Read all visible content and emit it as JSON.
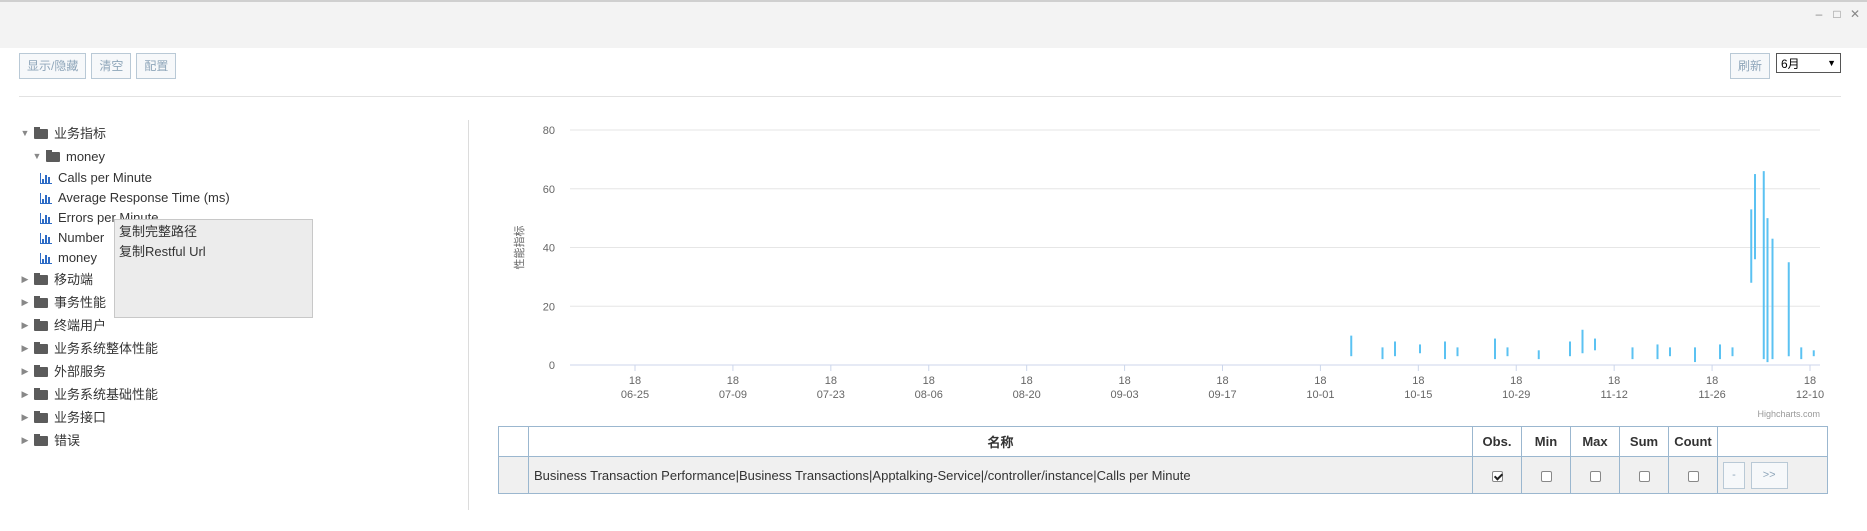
{
  "window": {
    "minimize_icon": "–",
    "maximize_icon": "□",
    "close_icon": "✕"
  },
  "toolbar": {
    "show_hide": "显示/隐藏",
    "clear": "清空",
    "config": "配置"
  },
  "right_toolbar": {
    "refresh": "刷新",
    "month_select": "6月",
    "select_arrow": "▼"
  },
  "tree": {
    "root": "业务指标",
    "child": "money",
    "metrics": [
      "Calls per Minute",
      "Average Response Time (ms)",
      "Errors per Minute",
      "Number",
      "money"
    ],
    "groups": [
      "移动端",
      "事务性能",
      "终端用户",
      "业务系统整体性能",
      "外部服务",
      "业务系统基础性能",
      "业务接口",
      "错误"
    ]
  },
  "context_menu": {
    "items": [
      "复制完整路径",
      "复制Restful Url"
    ]
  },
  "chart_data": {
    "type": "line",
    "ylabel": "性能指标",
    "ylim": [
      0,
      80
    ],
    "yticks": [
      0,
      20,
      40,
      60,
      80
    ],
    "xticks": [
      [
        "18",
        "06-25"
      ],
      [
        "18",
        "07-09"
      ],
      [
        "18",
        "07-23"
      ],
      [
        "18",
        "08-06"
      ],
      [
        "18",
        "08-20"
      ],
      [
        "18",
        "09-03"
      ],
      [
        "18",
        "09-17"
      ],
      [
        "18",
        "10-01"
      ],
      [
        "18",
        "10-15"
      ],
      [
        "18",
        "10-29"
      ],
      [
        "18",
        "11-12"
      ],
      [
        "18",
        "11-26"
      ],
      [
        "18",
        "12-10"
      ]
    ],
    "credits": "Highcharts.com",
    "series_color": "#5bc2f2",
    "spikes": [
      {
        "x": 0.625,
        "lo": 3,
        "hi": 10
      },
      {
        "x": 0.65,
        "lo": 2,
        "hi": 6
      },
      {
        "x": 0.66,
        "lo": 3,
        "hi": 8
      },
      {
        "x": 0.68,
        "lo": 4,
        "hi": 7
      },
      {
        "x": 0.7,
        "lo": 2,
        "hi": 8
      },
      {
        "x": 0.71,
        "lo": 3,
        "hi": 6
      },
      {
        "x": 0.74,
        "lo": 2,
        "hi": 9
      },
      {
        "x": 0.75,
        "lo": 3,
        "hi": 6
      },
      {
        "x": 0.775,
        "lo": 2,
        "hi": 5
      },
      {
        "x": 0.8,
        "lo": 3,
        "hi": 8
      },
      {
        "x": 0.81,
        "lo": 4,
        "hi": 12
      },
      {
        "x": 0.82,
        "lo": 5,
        "hi": 9
      },
      {
        "x": 0.85,
        "lo": 2,
        "hi": 6
      },
      {
        "x": 0.87,
        "lo": 2,
        "hi": 7
      },
      {
        "x": 0.88,
        "lo": 3,
        "hi": 6
      },
      {
        "x": 0.9,
        "lo": 1,
        "hi": 6
      },
      {
        "x": 0.92,
        "lo": 2,
        "hi": 7
      },
      {
        "x": 0.93,
        "lo": 3,
        "hi": 6
      },
      {
        "x": 0.945,
        "lo": 28,
        "hi": 53
      },
      {
        "x": 0.948,
        "lo": 36,
        "hi": 65
      },
      {
        "x": 0.955,
        "lo": 2,
        "hi": 66
      },
      {
        "x": 0.958,
        "lo": 1,
        "hi": 50
      },
      {
        "x": 0.962,
        "lo": 2,
        "hi": 43
      },
      {
        "x": 0.975,
        "lo": 3,
        "hi": 35
      },
      {
        "x": 0.985,
        "lo": 2,
        "hi": 6
      },
      {
        "x": 0.995,
        "lo": 3,
        "hi": 5
      }
    ]
  },
  "table": {
    "headers": [
      "名称",
      "Obs.",
      "Min",
      "Max",
      "Sum",
      "Count"
    ],
    "row": "Business Transaction Performance|Business Transactions|Apptalking-Service|/controller/instance|Calls per Minute",
    "checks": [
      true,
      false,
      false,
      false,
      false
    ],
    "prev_btn": "-",
    "next_btn": ">>"
  }
}
